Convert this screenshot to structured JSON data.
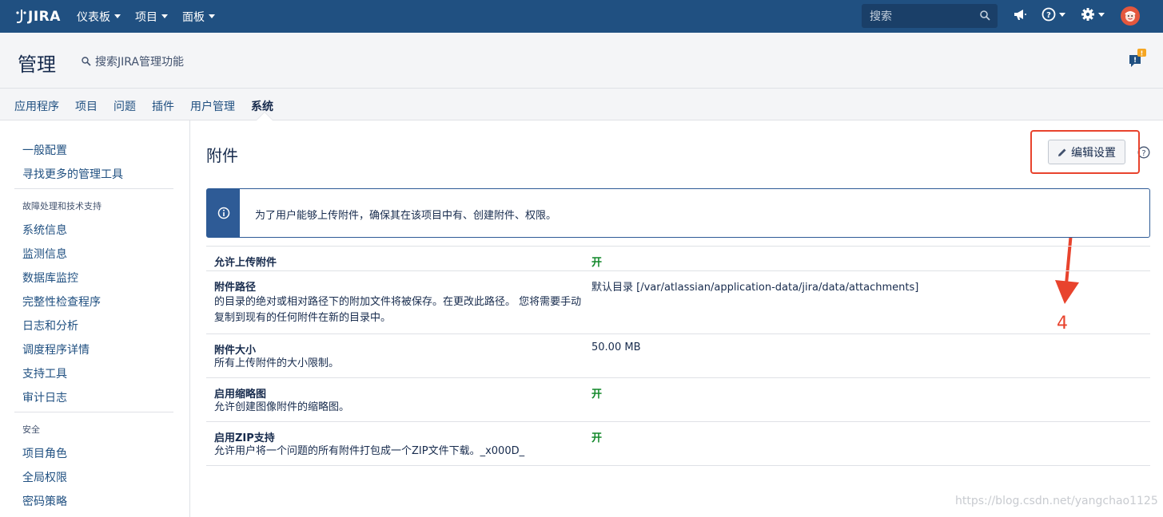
{
  "topbar": {
    "logo": "JIRA",
    "nav": [
      "仪表板",
      "项目",
      "面板"
    ],
    "search_placeholder": "搜索",
    "colors": {
      "bg": "#205081",
      "search_bg": "#1a3f68"
    }
  },
  "admin": {
    "title": "管理",
    "search_label": "搜索JIRA管理功能"
  },
  "tabs": [
    "应用程序",
    "项目",
    "问题",
    "插件",
    "用户管理",
    "系统"
  ],
  "active_tab": "系统",
  "sidebar": {
    "links_top": [
      "一般配置",
      "寻找更多的管理工具"
    ],
    "section1": "故障处理和技术支持",
    "links_1": [
      "系统信息",
      "监测信息",
      "数据库监控",
      "完整性检查程序",
      "日志和分析",
      "调度程序详情",
      "支持工具",
      "审计日志"
    ],
    "section2": "安全",
    "links_2": [
      "项目角色",
      "全局权限",
      "密码策略"
    ]
  },
  "main": {
    "title": "附件",
    "edit_button": "编辑设置",
    "info_message": "为了用户能够上传附件，确保其在该项目中有、创建附件、权限。",
    "annotation_number": "4",
    "settings": [
      {
        "name": "允许上传附件",
        "desc": "",
        "value": "开",
        "on": true
      },
      {
        "name": "附件路径",
        "desc": "的目录的绝对或相对路径下的附加文件将被保存。在更改此路径。 您将需要手动复制到现有的任何附件在新的目录中。",
        "value": "默认目录 [/var/atlassian/application-data/jira/data/attachments]",
        "on": false
      },
      {
        "name": "附件大小",
        "desc": "所有上传附件的大小限制。",
        "value": "50.00 MB",
        "on": false
      },
      {
        "name": "启用缩略图",
        "desc": "允许创建图像附件的缩略图。",
        "value": "开",
        "on": true
      },
      {
        "name": "启用ZIP支持",
        "desc": "允许用户将一个问题的所有附件打包成一个ZIP文件下载。_x000D_",
        "value": "开",
        "on": true
      }
    ]
  },
  "watermark": "https://blog.csdn.net/yangchao1125"
}
